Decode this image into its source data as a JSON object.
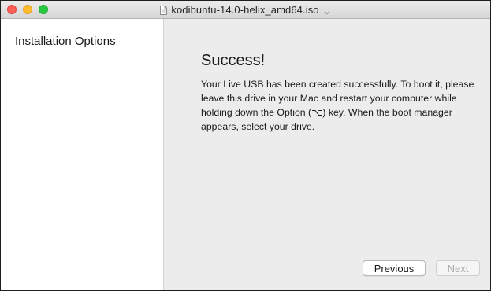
{
  "window": {
    "title": "kodibuntu-14.0-helix_amd64.iso"
  },
  "sidebar": {
    "items": [
      {
        "label": "Installation Options"
      }
    ]
  },
  "main": {
    "heading": "Success!",
    "message": "Your Live USB has been created successfully. To boot it, please leave this drive in your Mac and restart your computer while holding down the Option (⌥) key. When the boot manager appears, select your drive."
  },
  "buttons": {
    "previous_label": "Previous",
    "next_label": "Next",
    "next_enabled": false
  },
  "colors": {
    "close": "#fc5f57",
    "minimize": "#fdbc2e",
    "zoom": "#28c840",
    "content_bg": "#ececec",
    "sidebar_bg": "#ffffff"
  },
  "icons": {
    "title_document": "document-icon",
    "title_menu": "chevron-down-icon"
  }
}
